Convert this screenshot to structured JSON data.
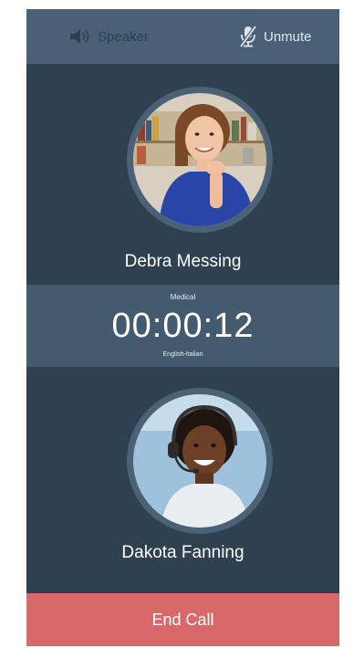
{
  "controls": {
    "speaker_label": "Speaker",
    "unmute_label": "Unmute"
  },
  "participants": [
    {
      "name": "Debra Messing"
    },
    {
      "name": "Dakota Fanning"
    }
  ],
  "call": {
    "category": "Medical",
    "timer": "00:00:12",
    "languages": "English-Italian"
  },
  "actions": {
    "end_call_label": "End Call"
  },
  "colors": {
    "background": "#2f4050",
    "top_bar": "#4a6076",
    "timer_band": "#445a6f",
    "end_call": "#d9686b"
  },
  "icons": {
    "speaker": "speaker-icon",
    "mic_muted": "microphone-muted-icon"
  }
}
